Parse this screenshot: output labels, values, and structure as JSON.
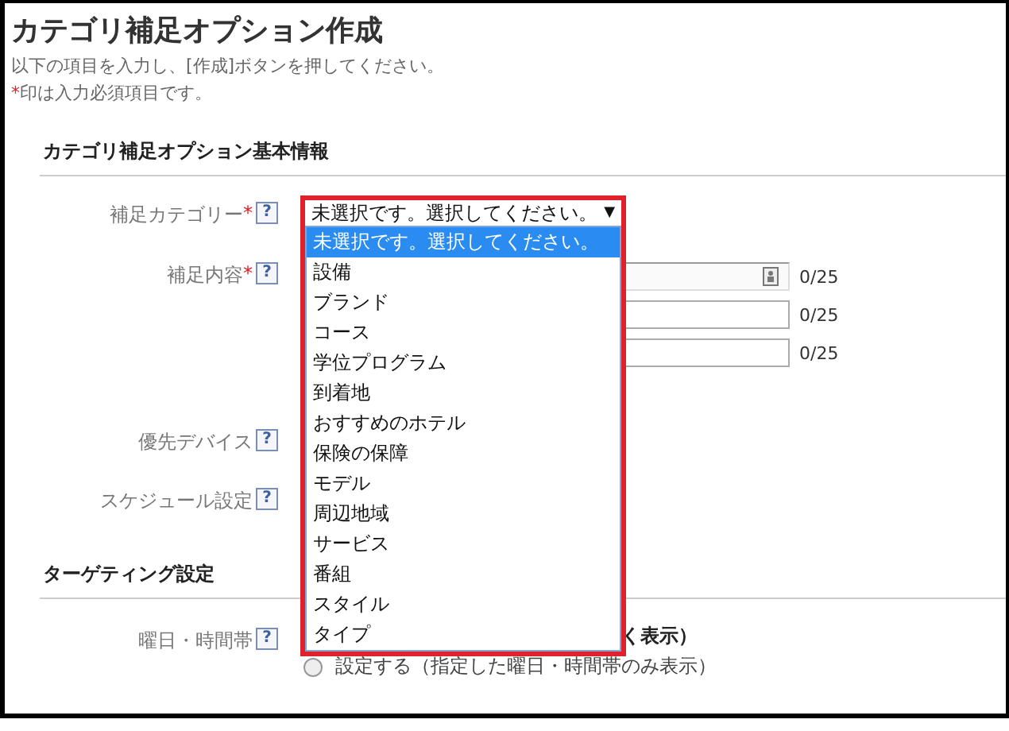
{
  "title": "カテゴリ補足オプション作成",
  "intro": "以下の項目を入力し、[作成]ボタンを押してください。",
  "required_note": {
    "mark": "*",
    "text": "印は入力必須項目です。"
  },
  "sections": [
    {
      "heading": "カテゴリ補足オプション基本情報",
      "rows": [
        {
          "label": "補足カテゴリー",
          "required": true,
          "help": "?",
          "kind": "select",
          "fields": []
        },
        {
          "label": "補足内容",
          "required": true,
          "help": "?",
          "kind": "inputs",
          "fields": [
            {
              "counter": "0/25",
              "icon": true
            },
            {
              "counter": "0/25",
              "icon": false
            },
            {
              "counter": "0/25",
              "icon": false
            }
          ]
        },
        {
          "label": "優先デバイス",
          "required": false,
          "help": "?",
          "kind": "blank",
          "fields": []
        },
        {
          "label": "スケジュール設定",
          "required": false,
          "help": "?",
          "kind": "blank",
          "fields": []
        }
      ]
    },
    {
      "heading": "ターゲティング設定",
      "rows": [
        {
          "label": "曜日・時間帯",
          "required": false,
          "help": "?",
          "kind": "radios",
          "fields": [],
          "lines": [
            {
              "kind": "text",
              "text": "く表示）"
            },
            {
              "kind": "radio",
              "selected": false,
              "text": "設定する（指定した曜日・時間帯のみ表示）"
            }
          ]
        }
      ]
    }
  ],
  "dropdown": {
    "value": "未選択です。選択してください。",
    "arrow": "▼",
    "options": [
      {
        "label": "未選択です。選択してください。",
        "selected": true
      },
      {
        "label": "設備",
        "selected": false
      },
      {
        "label": "ブランド",
        "selected": false
      },
      {
        "label": "コース",
        "selected": false
      },
      {
        "label": "学位プログラム",
        "selected": false
      },
      {
        "label": "到着地",
        "selected": false
      },
      {
        "label": "おすすめのホテル",
        "selected": false
      },
      {
        "label": "保険の保障",
        "selected": false
      },
      {
        "label": "モデル",
        "selected": false
      },
      {
        "label": "周辺地域",
        "selected": false
      },
      {
        "label": "サービス",
        "selected": false
      },
      {
        "label": "番組",
        "selected": false
      },
      {
        "label": "スタイル",
        "selected": false
      },
      {
        "label": "タイプ",
        "selected": false
      }
    ]
  }
}
